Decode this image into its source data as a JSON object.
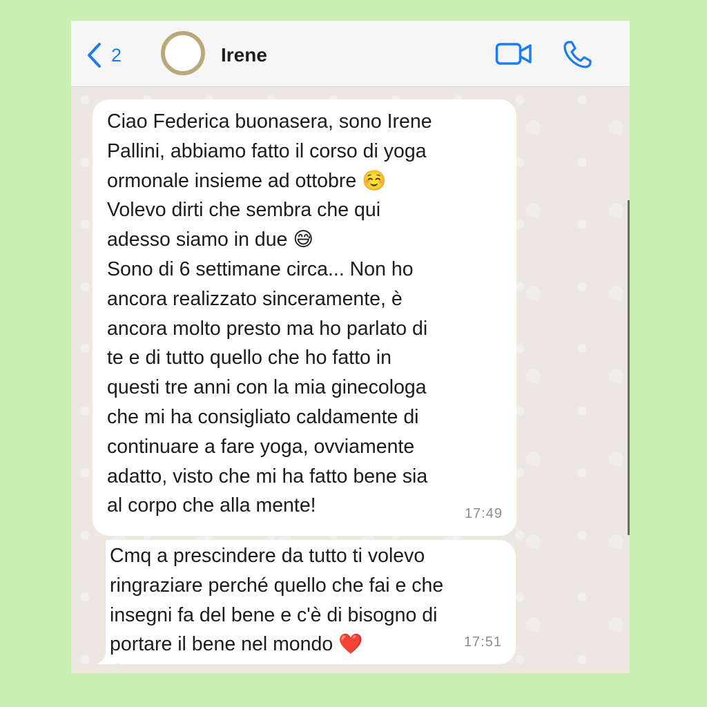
{
  "header": {
    "back_count": "2",
    "contact_name": "Irene",
    "icons": {
      "back": "chevron-left-icon",
      "video": "video-camera-icon",
      "call": "phone-icon"
    },
    "accent_color": "#1a7cf5"
  },
  "messages": [
    {
      "text": "Ciao Federica buonasera, sono Irene\nPallini, abbiamo fatto il corso di yoga\normonale insieme ad ottobre ☺️\nVolevo dirti che sembra che qui\nadesso siamo in due 😅\nSono di 6 settimane circa... Non ho\nancora realizzato sinceramente, è\nancora molto presto ma ho parlato di\nte e di tutto quello che ho fatto in\nquesti tre anni con la mia ginecologa\nche mi ha consigliato caldamente di\ncontinuare a fare yoga, ovviamente\nadatto, visto che mi ha fatto bene sia\nal corpo che alla mente!",
      "time": "17:49"
    },
    {
      "text": "Cmq a prescindere da tutto ti volevo\nringraziare perché quello che fai e che\ninsegni fa del bene e c'è di bisogno di\nportare il bene nel mondo ❤️",
      "time": "17:51"
    }
  ]
}
